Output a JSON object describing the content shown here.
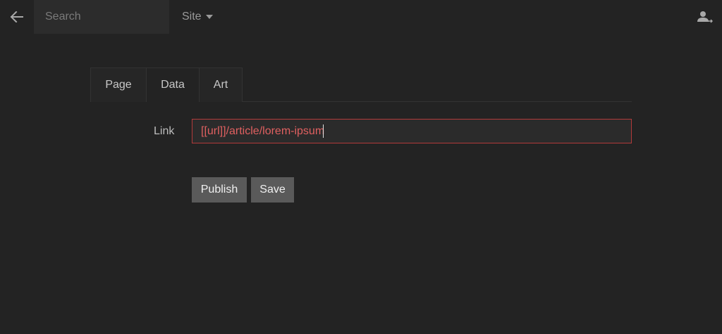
{
  "topbar": {
    "back_icon": "arrow-left-icon",
    "search": {
      "placeholder": "Search",
      "value": ""
    },
    "site_dropdown": {
      "label": "Site",
      "icon": "caret-down-icon"
    },
    "user_icon": "user-menu-icon"
  },
  "tabs": [
    {
      "label": "Page",
      "active": false
    },
    {
      "label": "Data",
      "active": true
    },
    {
      "label": "Art",
      "active": false
    }
  ],
  "form": {
    "link_label": "Link",
    "link_value": "[[url]]/article/lorem-ipsum"
  },
  "actions": {
    "publish_label": "Publish",
    "save_label": "Save"
  },
  "colors": {
    "background": "#232323",
    "error_border": "#b23a3a",
    "error_text": "#e06060",
    "button_bg": "#5a5a5a"
  }
}
